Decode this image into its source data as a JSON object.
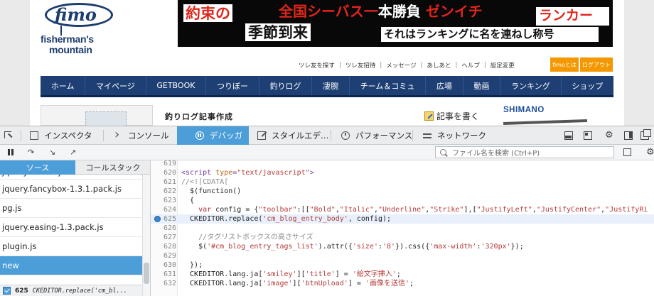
{
  "site": {
    "logo": {
      "word": "fimo",
      "line1": "fisherman's",
      "line2": "mountain"
    },
    "banner": {
      "line1_left": "約束の",
      "line1_title_pre": "全国シーバス",
      "line1_title_dash": "一",
      "line1_title_mid": "本勝負 ",
      "line1_title_red": "ゼンイチ",
      "line1_badge": "ランカー",
      "line2_left": "季節到来",
      "line2_right": "それはランキングに名を連ねし称号"
    },
    "top_links": [
      "ツレ友を探す",
      "ツレ友招待",
      "メッセージ",
      "あしあと",
      "ヘルプ",
      "設定変更"
    ],
    "fimo_button": "fimoとは",
    "logout_button": "ログアウト",
    "nav": [
      "ホーム",
      "マイページ",
      "GETBOOK",
      "つりぼー",
      "釣りログ",
      "凄腕",
      "チーム＆コミュ",
      "広場",
      "動画",
      "ランキング",
      "ショップ"
    ],
    "section_title": "釣りログ記事作成",
    "write_link": "記事を書く",
    "sponsor": "SHIMANO"
  },
  "devtools": {
    "tabs": [
      {
        "label": "インスペクタ",
        "icon": "inspector-icon",
        "active": false
      },
      {
        "label": "コンソール",
        "icon": "console-icon",
        "active": false
      },
      {
        "label": "デバッガ",
        "icon": "debugger-icon",
        "active": true
      },
      {
        "label": "スタイルエデ…",
        "icon": "style-editor-icon",
        "active": false
      },
      {
        "label": "パフォーマンス",
        "icon": "performance-icon",
        "active": false
      },
      {
        "label": "ネットワーク",
        "icon": "network-icon",
        "active": false
      }
    ],
    "search_placeholder": "ファイル名を検索 (Ctrl+P)",
    "pane_tabs": [
      "ソース",
      "コールスタック"
    ],
    "files": [
      "jquery.cookie.js",
      "jquery.fancybox-1.3.1.pack.js",
      "pg.js",
      "jquery.easing-1.3.pack.js",
      "plugin.js",
      "new"
    ],
    "selected_file": "new",
    "breakpoint": {
      "line": "625",
      "code": "CKEDITOR.replace('cm_bl..."
    },
    "code": [
      {
        "ln": "619",
        "parts": []
      },
      {
        "ln": "620",
        "parts": [
          [
            "c-tag",
            "<script "
          ],
          [
            "c-attr",
            "type"
          ],
          [
            "c-tag",
            "="
          ],
          [
            "c-str",
            "\"text/javascript\""
          ],
          [
            "c-tag",
            ">"
          ]
        ]
      },
      {
        "ln": "621",
        "parts": [
          [
            "c-cm",
            "//<![CDATA["
          ]
        ]
      },
      {
        "ln": "622",
        "parts": [
          [
            "c-fn",
            "  $(function()"
          ]
        ]
      },
      {
        "ln": "623",
        "parts": [
          [
            "c-fn",
            "  {"
          ]
        ]
      },
      {
        "ln": "624",
        "parts": [
          [
            "c-fn",
            "    "
          ],
          [
            "c-kw",
            "var"
          ],
          [
            "c-fn",
            " config = {"
          ],
          [
            "c-str",
            "\"toolbar\""
          ],
          [
            "c-fn",
            ":[["
          ],
          [
            "c-str",
            "\"Bold\""
          ],
          [
            "c-fn",
            ","
          ],
          [
            "c-str",
            "\"Italic\""
          ],
          [
            "c-fn",
            ","
          ],
          [
            "c-str",
            "\"Underline\""
          ],
          [
            "c-fn",
            ","
          ],
          [
            "c-str",
            "\"Strike\""
          ],
          [
            "c-fn",
            "],["
          ],
          [
            "c-str",
            "\"JustifyLeft\""
          ],
          [
            "c-fn",
            ","
          ],
          [
            "c-str",
            "\"JustifyCenter\""
          ],
          [
            "c-fn",
            ","
          ],
          [
            "c-str",
            "\"JustifyRi"
          ]
        ]
      },
      {
        "ln": "625",
        "parts": [
          [
            "c-fn",
            "  CKEDITOR.replace("
          ],
          [
            "c-str",
            "'cm_blog_entry_body'"
          ],
          [
            "c-fn",
            ", config);"
          ]
        ],
        "highlight": true,
        "breakpoint": true
      },
      {
        "ln": "626",
        "parts": []
      },
      {
        "ln": "627",
        "parts": [
          [
            "c-cm",
            "    //タグリストボックスの高さサイズ"
          ]
        ]
      },
      {
        "ln": "628",
        "parts": [
          [
            "c-fn",
            "    $("
          ],
          [
            "c-str",
            "'#cm_blog_entry_tags_list'"
          ],
          [
            "c-fn",
            ").attr({"
          ],
          [
            "c-str",
            "'size'"
          ],
          [
            "c-fn",
            ":"
          ],
          [
            "c-str",
            "'8'"
          ],
          [
            "c-fn",
            "}).css({"
          ],
          [
            "c-str",
            "'max-width'"
          ],
          [
            "c-fn",
            ":"
          ],
          [
            "c-str",
            "'320px'"
          ],
          [
            "c-fn",
            "});"
          ]
        ]
      },
      {
        "ln": "629",
        "parts": []
      },
      {
        "ln": "630",
        "parts": [
          [
            "c-fn",
            "  });"
          ]
        ]
      },
      {
        "ln": "631",
        "parts": [
          [
            "c-fn",
            "  CKEDITOR.lang.ja["
          ],
          [
            "c-str",
            "'smiley'"
          ],
          [
            "c-fn",
            "]["
          ],
          [
            "c-str",
            "'title'"
          ],
          [
            "c-fn",
            "] = "
          ],
          [
            "c-str",
            "'絵文字挿入'"
          ],
          [
            "c-fn",
            ";"
          ]
        ]
      },
      {
        "ln": "632",
        "parts": [
          [
            "c-fn",
            "  CKEDITOR.lang.ja["
          ],
          [
            "c-str",
            "'image'"
          ],
          [
            "c-fn",
            "]["
          ],
          [
            "c-str",
            "'btnUpload'"
          ],
          [
            "c-fn",
            "] = "
          ],
          [
            "c-str",
            "'画像を送信'"
          ],
          [
            "c-fn",
            ";"
          ]
        ]
      }
    ]
  }
}
